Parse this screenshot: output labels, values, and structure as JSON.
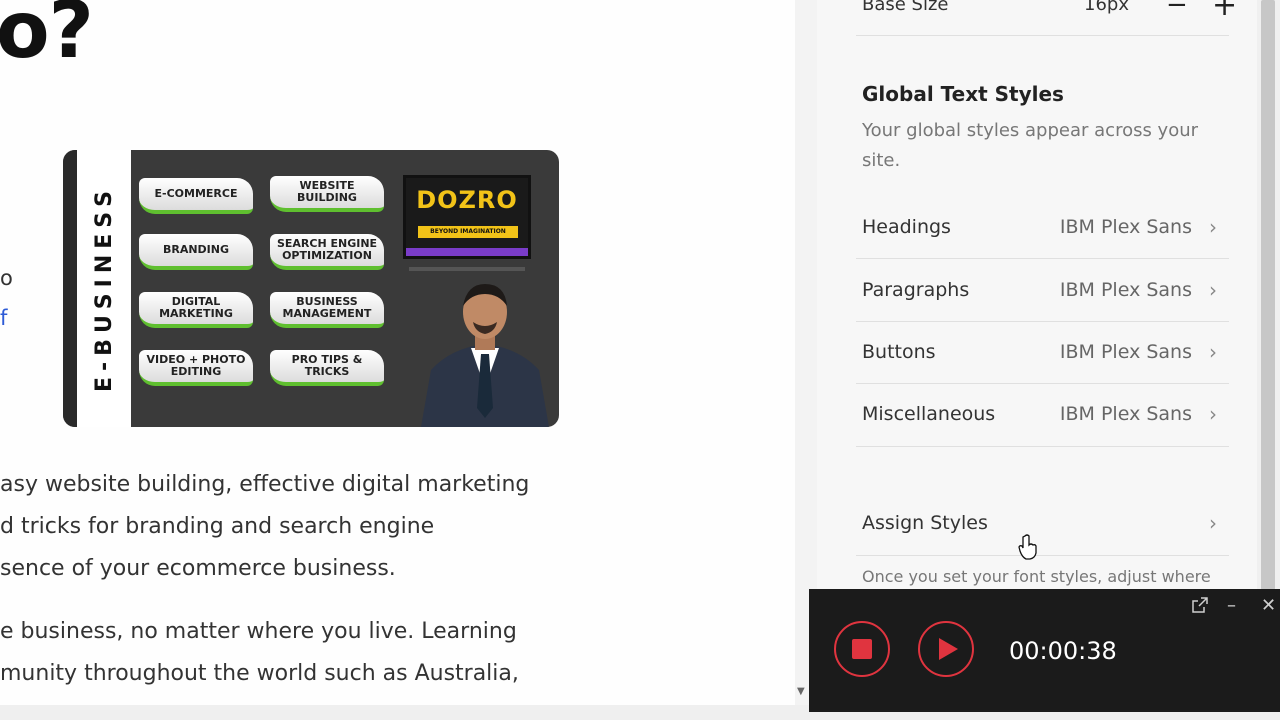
{
  "canvas": {
    "heading_fragment": "o?",
    "side_fragments": [
      "o",
      "f"
    ],
    "thumbnail": {
      "vertical_text": "E-BUSINESS",
      "pills": [
        "E-COMMERCE",
        "WEBSITE BUILDING",
        "BRANDING",
        "SEARCH ENGINE OPTIMIZATION",
        "DIGITAL MARKETING",
        "BUSINESS MANAGEMENT",
        "VIDEO + PHOTO EDITING",
        "PRO TIPS & TRICKS"
      ],
      "brand": "DOZRO",
      "tagline": "BEYOND IMAGINATION"
    },
    "paragraph_lines": [
      "asy website building, effective digital marketing",
      "d tricks for branding and search engine",
      "sence of your ecommerce business.",
      "e business, no matter where you live. Learning",
      "munity throughout the world such as Australia,"
    ]
  },
  "panel": {
    "base_size_label": "Base Size",
    "base_size_value": "16px",
    "minus_symbol": "−",
    "plus_symbol": "+",
    "global_title": "Global Text Styles",
    "global_desc": "Your global styles appear across your site.",
    "styles": [
      {
        "name": "Headings",
        "font": "IBM Plex Sans"
      },
      {
        "name": "Paragraphs",
        "font": "IBM Plex Sans"
      },
      {
        "name": "Buttons",
        "font": "IBM Plex Sans"
      },
      {
        "name": "Miscellaneous",
        "font": "IBM Plex Sans"
      }
    ],
    "assign_label": "Assign Styles",
    "hint_text": "Once you set your font styles, adjust where"
  },
  "recorder": {
    "timer": "00:00:38",
    "accent": "#e0343f"
  },
  "colors": {
    "link_blue": "#2d5bd6",
    "pill_green": "#5fbf2f",
    "brand_yellow": "#f2c318",
    "recorder_bg": "#1b1b1b"
  }
}
